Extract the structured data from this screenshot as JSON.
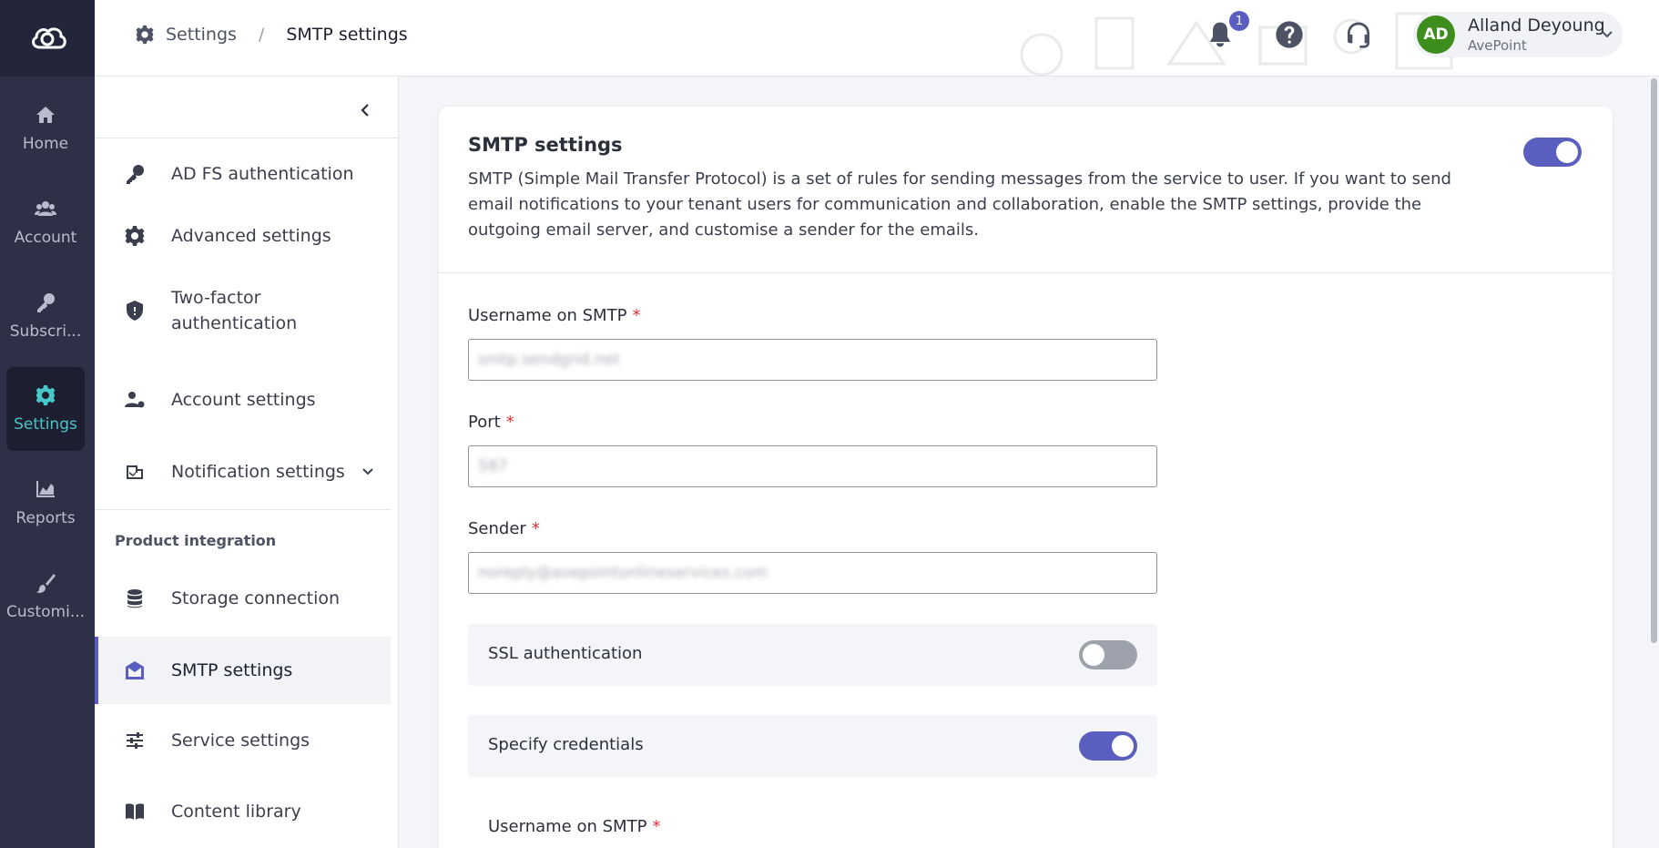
{
  "rail": {
    "items": [
      {
        "label": "Home",
        "icon": "home-icon"
      },
      {
        "label": "Account",
        "icon": "users-icon"
      },
      {
        "label": "Subscri...",
        "icon": "key-icon"
      },
      {
        "label": "Settings",
        "icon": "gear-icon",
        "active": true
      },
      {
        "label": "Reports",
        "icon": "chart-icon"
      },
      {
        "label": "Customi...",
        "icon": "brush-icon"
      }
    ]
  },
  "header": {
    "breadcrumb": {
      "parent": "Settings",
      "separator": "/",
      "current": "SMTP settings"
    },
    "notification_count": "1",
    "user": {
      "initials": "AD",
      "name": "Alland Deyoung",
      "org": "AvePoint"
    }
  },
  "subnav": {
    "items": [
      {
        "label": "AD FS authentication",
        "icon": "key-icon"
      },
      {
        "label": "Advanced settings",
        "icon": "gear-icon"
      },
      {
        "label": "Two-factor authentication",
        "icon": "shield-icon"
      },
      {
        "label": "Account settings",
        "icon": "user-gear-icon"
      },
      {
        "label": "Notification settings",
        "icon": "notification-icon",
        "expandable": true
      }
    ],
    "group_label": "Product integration",
    "group_items": [
      {
        "label": "Storage connection",
        "icon": "database-icon"
      },
      {
        "label": "SMTP settings",
        "icon": "mail-icon",
        "active": true
      },
      {
        "label": "Service settings",
        "icon": "sliders-icon"
      },
      {
        "label": "Content library",
        "icon": "book-icon"
      }
    ]
  },
  "card": {
    "title": "SMTP settings",
    "description": "SMTP (Simple Mail Transfer Protocol) is a set of rules for sending messages from the service to user. If you want to send email notifications to your tenant users for communication and collaboration, enable the SMTP settings, provide the outgoing email server, and customise a sender for the emails.",
    "enabled": true,
    "fields": [
      {
        "label": "Username on SMTP",
        "required": "*",
        "value": "smtp.sendgrid.net"
      },
      {
        "label": "Port",
        "required": "*",
        "value": "587"
      },
      {
        "label": "Sender",
        "required": "*",
        "value": "noreply@avepointonlineservices.com"
      }
    ],
    "switches": [
      {
        "label": "SSL authentication",
        "on": false
      },
      {
        "label": "Specify credentials",
        "on": true
      }
    ],
    "credentials_username_label": "Username on SMTP",
    "credentials_username_required": "*"
  },
  "colors": {
    "accent": "#5a5fbf",
    "rail_bg": "#2e3047",
    "active_rail": "#49c6c8",
    "required": "#d13438"
  }
}
